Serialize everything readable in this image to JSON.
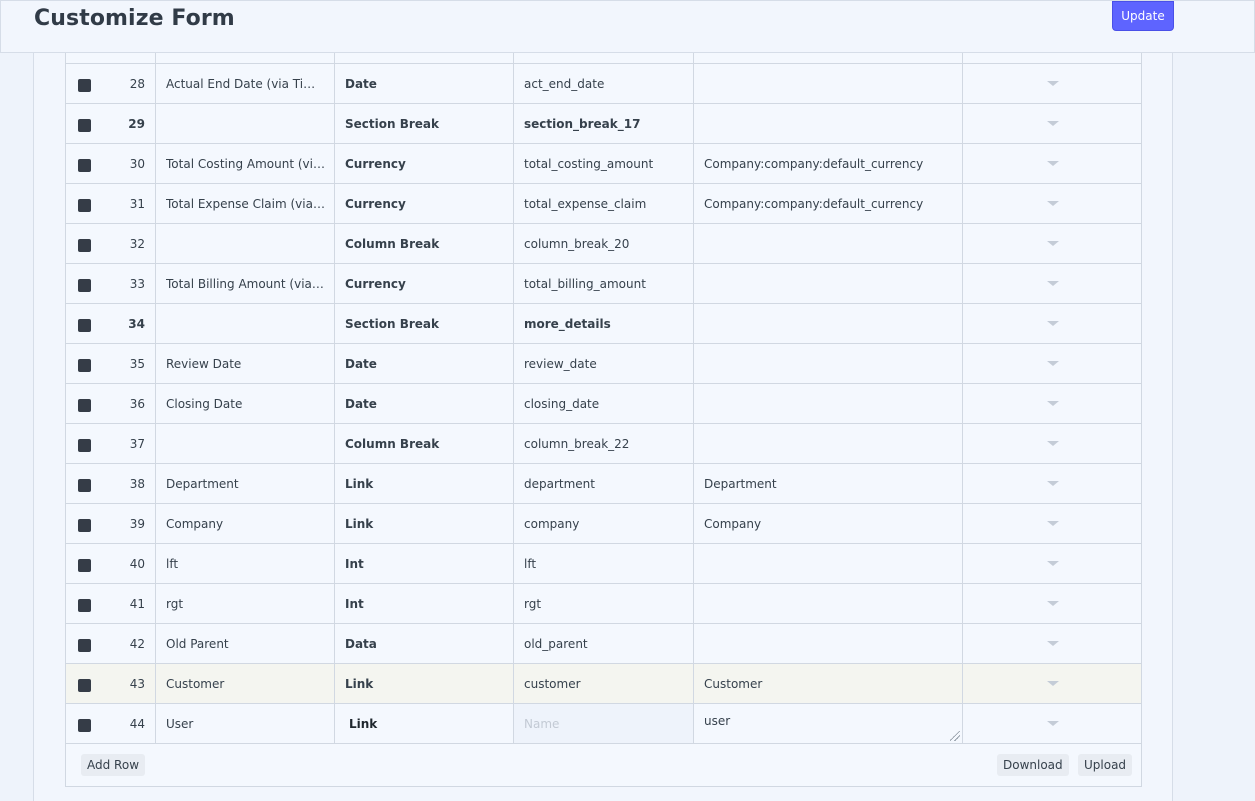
{
  "header": {
    "title": "Customize Form",
    "update_label": "Update"
  },
  "rows": [
    {
      "idx": "28",
      "label": "Actual End Date (via Time Sheet)",
      "type": "Date",
      "fieldname": "act_end_date",
      "options": "",
      "bold": false
    },
    {
      "idx": "29",
      "label": "",
      "type": "Section Break",
      "fieldname": "section_break_17",
      "options": "",
      "bold": true
    },
    {
      "idx": "30",
      "label": "Total Costing Amount (via Time Sheet)",
      "type": "Currency",
      "fieldname": "total_costing_amount",
      "options": "Company:company:default_currency",
      "bold": false
    },
    {
      "idx": "31",
      "label": "Total Expense Claim (via Expense Claim)",
      "type": "Currency",
      "fieldname": "total_expense_claim",
      "options": "Company:company:default_currency",
      "bold": false
    },
    {
      "idx": "32",
      "label": "",
      "type": "Column Break",
      "fieldname": "column_break_20",
      "options": "",
      "bold": false
    },
    {
      "idx": "33",
      "label": "Total Billing Amount (via Time Sheet)",
      "type": "Currency",
      "fieldname": "total_billing_amount",
      "options": "",
      "bold": false
    },
    {
      "idx": "34",
      "label": "",
      "type": "Section Break",
      "fieldname": "more_details",
      "options": "",
      "bold": true
    },
    {
      "idx": "35",
      "label": "Review Date",
      "type": "Date",
      "fieldname": "review_date",
      "options": "",
      "bold": false
    },
    {
      "idx": "36",
      "label": "Closing Date",
      "type": "Date",
      "fieldname": "closing_date",
      "options": "",
      "bold": false
    },
    {
      "idx": "37",
      "label": "",
      "type": "Column Break",
      "fieldname": "column_break_22",
      "options": "",
      "bold": false
    },
    {
      "idx": "38",
      "label": "Department",
      "type": "Link",
      "fieldname": "department",
      "options": "Department",
      "bold": false
    },
    {
      "idx": "39",
      "label": "Company",
      "type": "Link",
      "fieldname": "company",
      "options": "Company",
      "bold": false
    },
    {
      "idx": "40",
      "label": "lft",
      "type": "Int",
      "fieldname": "lft",
      "options": "",
      "bold": false
    },
    {
      "idx": "41",
      "label": "rgt",
      "type": "Int",
      "fieldname": "rgt",
      "options": "",
      "bold": false
    },
    {
      "idx": "42",
      "label": "Old Parent",
      "type": "Data",
      "fieldname": "old_parent",
      "options": "",
      "bold": false
    },
    {
      "idx": "43",
      "label": "Customer",
      "type": "Link",
      "fieldname": "customer",
      "options": "Customer",
      "bold": false,
      "highlight": true
    }
  ],
  "editing_row": {
    "idx": "44",
    "label": "User",
    "type": "Link",
    "fieldname_placeholder": "Name",
    "fieldname_value": "",
    "options": "user"
  },
  "footer": {
    "add_row_label": "Add Row",
    "download_label": "Download",
    "upload_label": "Upload"
  },
  "icons": {
    "row_action": "chevron-down-icon",
    "checkbox": "checkbox"
  }
}
